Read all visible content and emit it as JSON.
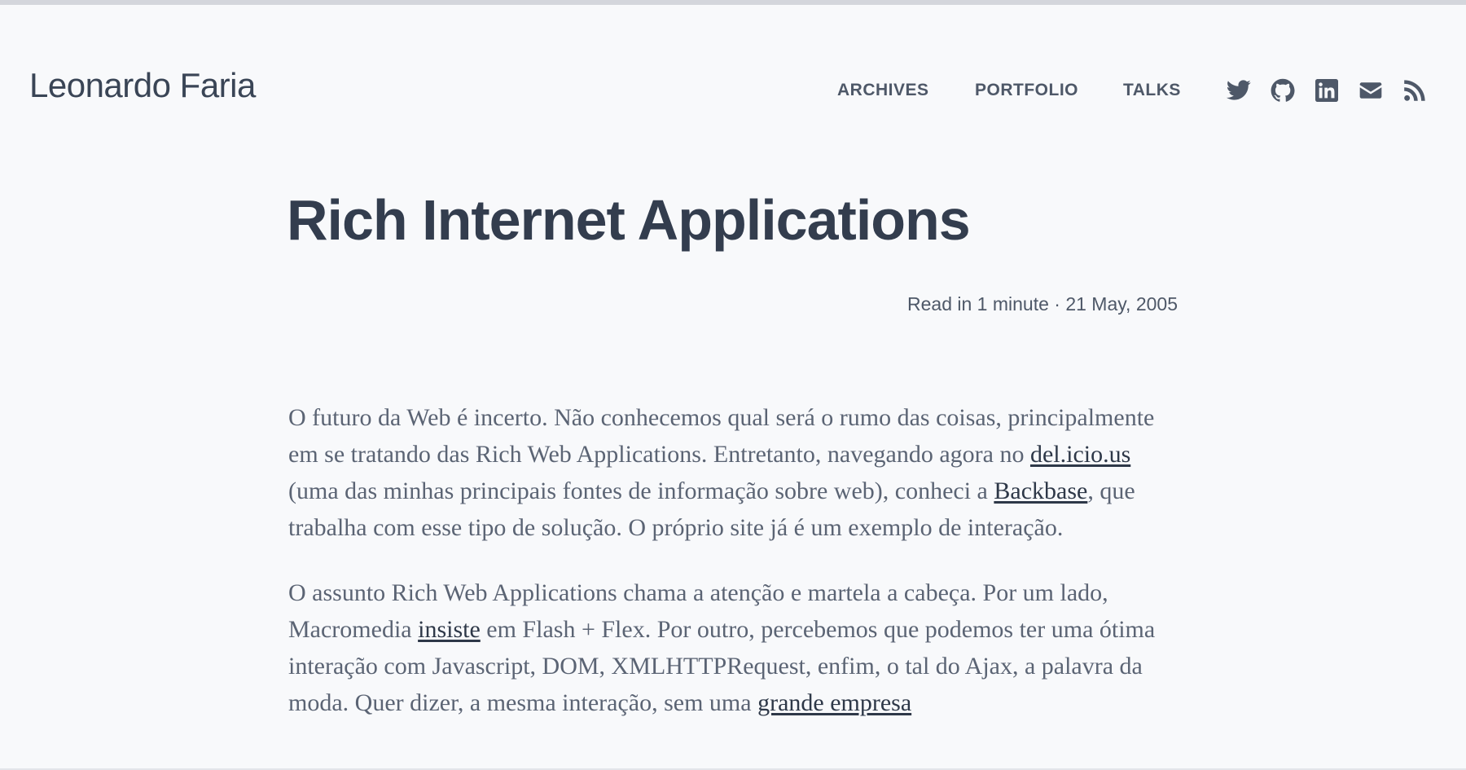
{
  "site": {
    "title": "Leonardo Faria"
  },
  "nav": {
    "items": [
      {
        "label": "ARCHIVES"
      },
      {
        "label": "PORTFOLIO"
      },
      {
        "label": "TALKS"
      }
    ]
  },
  "social": {
    "icons": [
      "twitter-icon",
      "github-icon",
      "linkedin-icon",
      "email-icon",
      "rss-icon"
    ],
    "icon_color": "#4e5868"
  },
  "post": {
    "title": "Rich Internet Applications",
    "meta": "Read in 1 minute · 21 May, 2005",
    "p1": {
      "t1": "O futuro da Web é incerto. Não conhecemos qual será o rumo das coisas, principalmente em se tratando das Rich Web Applications. Entretanto, navegando agora no ",
      "link1": "del.icio.us",
      "t2": " (uma das minhas principais fontes de informação sobre web), conheci a ",
      "link2": "Backbase",
      "t3": ", que trabalha com esse tipo de solução. O próprio site já é um exemplo de interação."
    },
    "p2": {
      "t1": "O assunto Rich Web Applications chama a atenção e martela a cabeça. Por um lado, Macromedia ",
      "link1": "insiste",
      "t2": " em Flash + Flex. Por outro, percebemos que podemos ter uma ótima interação com Javascript, DOM, XMLHTTPRequest, enfim, o tal do Ajax, a palavra da moda. Quer dizer, a mesma interação, sem uma ",
      "link2": "grande empresa"
    }
  },
  "colors": {
    "background": "#f8f9fb",
    "text": "#3a4556",
    "body_text": "#5b6474",
    "link": "#2e3848"
  }
}
